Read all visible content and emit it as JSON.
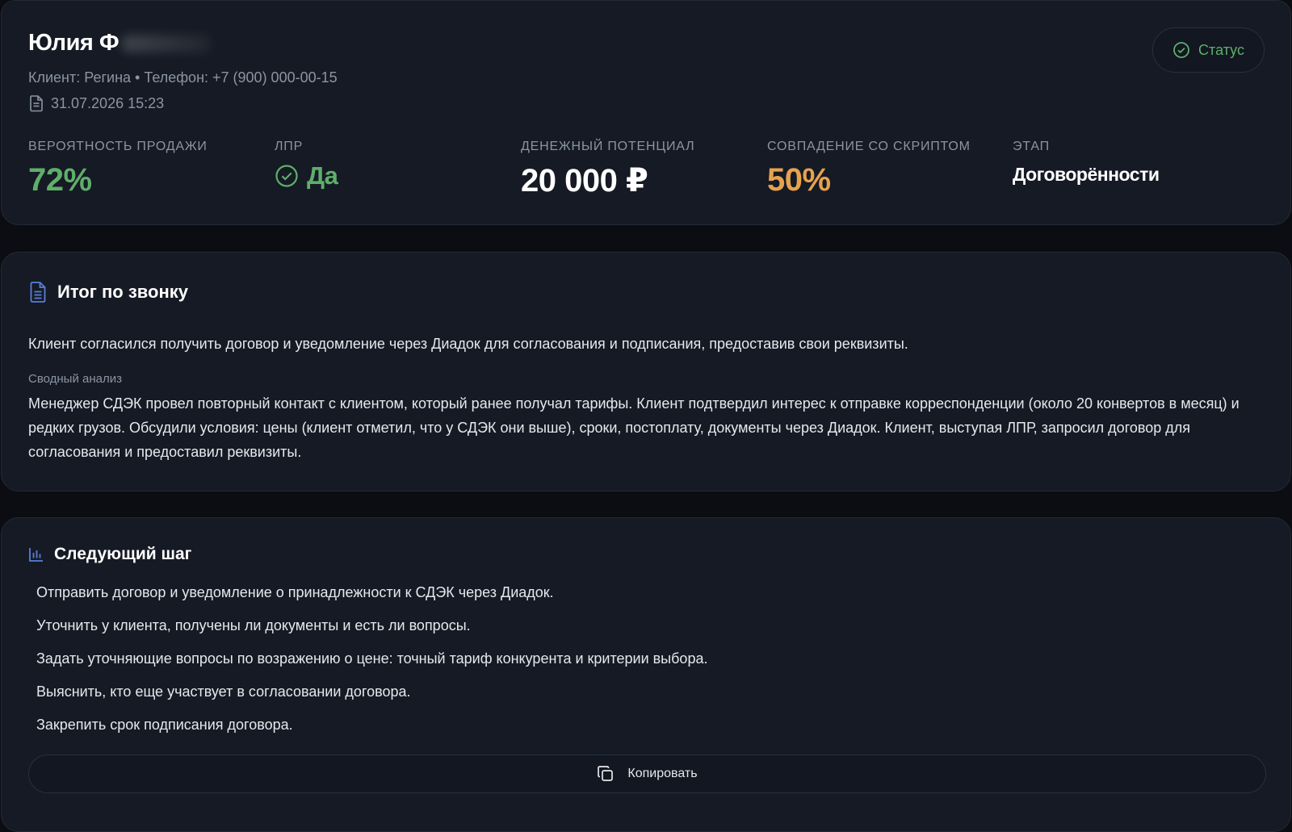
{
  "header": {
    "client_name": "Юлия Ф",
    "meta": "Клиент: Регина • Телефон: +7 (900) 000-00-15",
    "datetime": "31.07.2026 15:23",
    "status_label": "Статус",
    "icons": {
      "date": "document-icon",
      "status": "check-circle-icon"
    }
  },
  "metrics": {
    "probability": {
      "label": "Вероятность продажи",
      "value": "72%"
    },
    "lpr": {
      "label": "ЛПР",
      "value": "Да"
    },
    "potential": {
      "label": "Денежный потенциал",
      "value": "20 000 ₽"
    },
    "script_match": {
      "label": "Совпадение со скриптом",
      "value": "50%"
    },
    "stage": {
      "label": "Этап",
      "value": "Договорённости"
    }
  },
  "summary": {
    "title": "Итог по звонку",
    "text": "Клиент согласился получить договор и уведомление через Диадок для согласования и подписания, предоставив свои реквизиты.",
    "analysis_label": "Сводный анализ",
    "analysis": "Менеджер СДЭК провел повторный контакт с клиентом, который ранее получал тарифы. Клиент подтвердил интерес к отправке корреспонденции (около 20 конвертов в месяц) и редких грузов. Обсудили условия: цены (клиент отметил, что у СДЭК они выше), сроки, постоплату, документы через Диадок. Клиент, выступая ЛПР, запросил договор для согласования и предоставил реквизиты."
  },
  "next_step": {
    "title": "Следующий шаг",
    "items": [
      "Отправить договор и уведомление о принадлежности к СДЭК через Диадок.",
      "Уточнить у клиента, получены ли документы и есть ли вопросы.",
      "Задать уточняющие вопросы по возражению о цене: точный тариф конкурента и критерии выбора.",
      "Выяснить, кто еще участвует в согласовании договора.",
      "Закрепить срок подписания договора."
    ],
    "copy_label": "Копировать"
  },
  "colors": {
    "accent_green": "#5fae6b",
    "accent_orange": "#e6a24e",
    "accent_blue": "#5b7fd6"
  }
}
